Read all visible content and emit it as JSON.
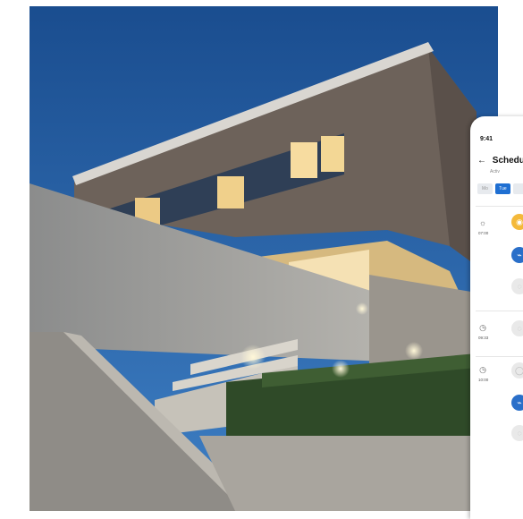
{
  "phone": {
    "status_time": "9:41",
    "header_title": "Schedul",
    "header_subtitle": "Activ",
    "days": [
      {
        "label": "Mo",
        "active": false
      },
      {
        "label": "Tue",
        "active": true
      }
    ],
    "times": [
      "07:00",
      "09:33",
      "10:00"
    ],
    "accent_color": "#1f6fd2",
    "amber_color": "#f4b93a"
  }
}
